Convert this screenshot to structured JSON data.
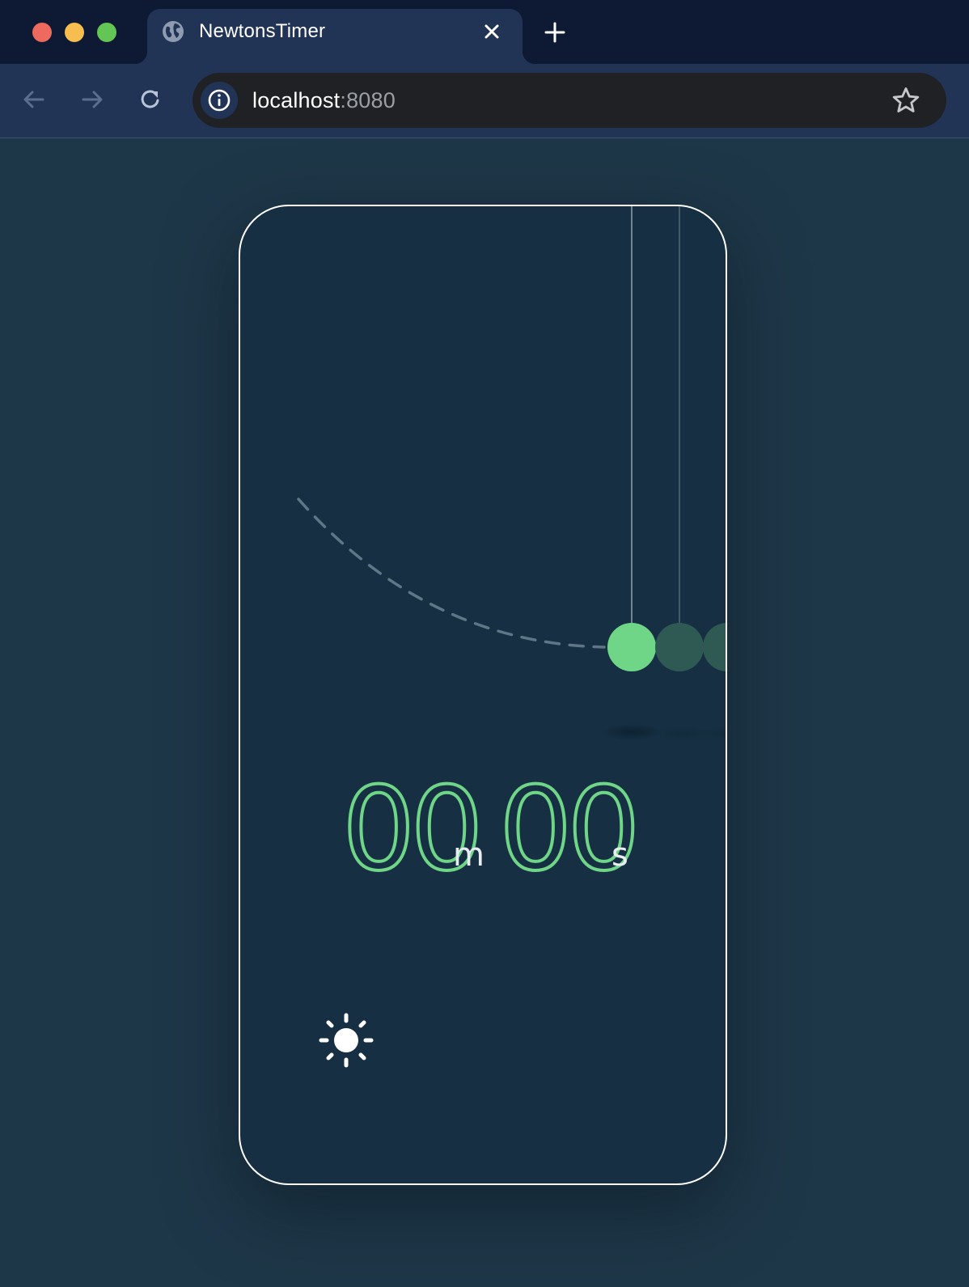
{
  "browser": {
    "tab": {
      "title": "NewtonsTimer",
      "favicon": "globe-icon"
    },
    "address_bar": {
      "host": "localhost",
      "port": ":8080"
    },
    "icons": {
      "close_tab": "close-icon",
      "new_tab": "plus-icon",
      "back": "arrow-left-icon",
      "forward": "arrow-right-icon",
      "reload": "reload-icon",
      "site_info": "info-icon",
      "bookmark": "star-icon"
    }
  },
  "app": {
    "timer": {
      "minutes": "00",
      "minutes_unit": "m",
      "seconds": "00",
      "seconds_unit": "s"
    },
    "theme_toggle_icon": "sun-icon",
    "colors": {
      "accent": "#6fd688",
      "ball_inactive": "#2f5a53",
      "card_background": "#162f42",
      "page_background": "#1e3748"
    }
  }
}
